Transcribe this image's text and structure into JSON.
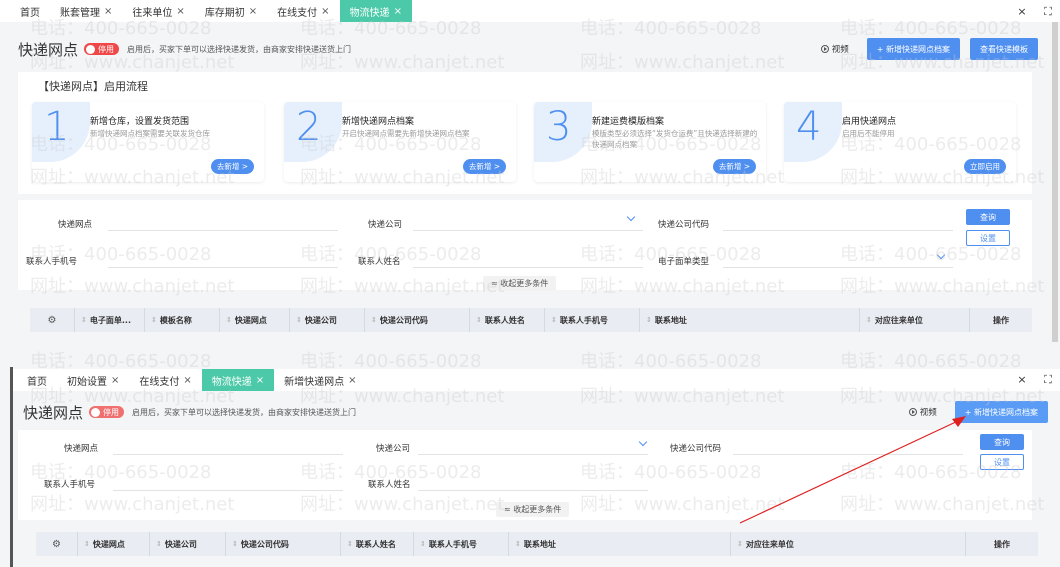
{
  "top": {
    "tabs": [
      {
        "label": "首页",
        "close": ""
      },
      {
        "label": "账套管理",
        "close": "×"
      },
      {
        "label": "往来单位",
        "close": "×"
      },
      {
        "label": "库存期初",
        "close": "×"
      },
      {
        "label": "在线支付",
        "close": "×"
      },
      {
        "label": "物流快递",
        "close": "×"
      }
    ],
    "win_close": "×",
    "win_max": "⛶",
    "header": {
      "title": "快递网点",
      "toggle": "停用",
      "desc": "启用后，买家下单可以选择快递发货，由商家安排快递送货上门",
      "video": "视频",
      "add_btn": "+ 新增快递网点档案",
      "template_btn": "查看快递模板"
    },
    "flow": {
      "title": "【快递网点】启用流程",
      "steps": [
        {
          "num": "1",
          "title": "新增仓库，设置发货范围",
          "desc": "新增快递网点档案需要关联发货仓库",
          "btn": "去新增 >"
        },
        {
          "num": "2",
          "title": "新增快递网点档案",
          "desc": "开启快递网点需要先新增快递网点档案",
          "btn": "去新增 >"
        },
        {
          "num": "3",
          "title": "新建运费模版档案",
          "desc": "模版类型必须选择“发货仓运费”且快递选择新建的快递网点档案",
          "btn": "去新增 >"
        },
        {
          "num": "4",
          "title": "启用快递网点",
          "desc": "启用后不能停用",
          "btn": "立即启用"
        }
      ]
    },
    "filter": {
      "f1": "快递网点",
      "f2": "快递公司",
      "f3": "快递公司代码",
      "f4": "联系人手机号",
      "f5": "联系人姓名",
      "f6": "电子面单类型",
      "query": "查询",
      "settings": "设置",
      "collapse": "≈ 收起更多条件"
    },
    "table": {
      "cols": [
        "电子面单...",
        "模板名称",
        "快递网点",
        "快递公司",
        "快递公司代码",
        "联系人姓名",
        "联系人手机号",
        "联系地址",
        "对应往来单位",
        "操作"
      ]
    }
  },
  "bottom": {
    "tabs": [
      {
        "label": "首页",
        "close": ""
      },
      {
        "label": "初始设置",
        "close": "×"
      },
      {
        "label": "在线支付",
        "close": "×"
      },
      {
        "label": "物流快递",
        "close": "×"
      },
      {
        "label": "新增快递网点",
        "close": "×"
      }
    ],
    "header": {
      "title": "快递网点",
      "toggle": "停用",
      "desc": "启用后，买家下单可以选择快递发货，由商家安排快递送货上门",
      "video": "视频",
      "add_btn": "+ 新增快递网点档案"
    },
    "filter": {
      "f1": "快递网点",
      "f2": "快递公司",
      "f3": "快递公司代码",
      "f4": "联系人手机号",
      "f5": "联系人姓名",
      "query": "查询",
      "settings": "设置",
      "collapse": "≈ 收起更多条件"
    },
    "table": {
      "cols": [
        "快递网点",
        "快递公司",
        "快递公司代码",
        "联系人姓名",
        "联系人手机号",
        "联系地址",
        "对应往来单位",
        "操作"
      ]
    }
  },
  "watermark": {
    "phone": "电话：400-665-0028",
    "site": "网址：www.chanjet.net"
  },
  "colors": {
    "accent": "#4f8ff0",
    "active_tab": "#4cc9a8",
    "toggle": "#f04848",
    "arrow": "#e02020"
  }
}
